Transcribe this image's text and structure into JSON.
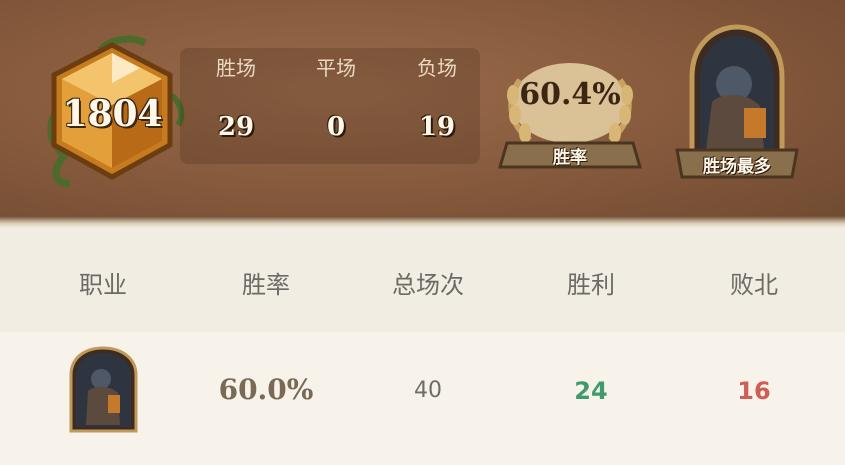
{
  "rank": {
    "value": "1804",
    "icon": "hexagon-rank-icon"
  },
  "stats": {
    "labels": [
      "胜场",
      "平场",
      "负场"
    ],
    "values": [
      "29",
      "0",
      "19"
    ]
  },
  "win_rate": {
    "value": "60.4%",
    "label": "胜率"
  },
  "most_wins": {
    "label": "胜场最多",
    "icon": "hero-portrait-icon"
  },
  "table": {
    "headers": [
      "职业",
      "胜率",
      "总场次",
      "胜利",
      "败北"
    ],
    "rows": [
      {
        "win_rate": "60.0%",
        "total": "40",
        "wins": "24",
        "losses": "16",
        "icon": "hero-portrait-icon"
      }
    ]
  },
  "colors": {
    "win": "#3f9a6d",
    "loss": "#cf5e55",
    "header_bg": "#84583b"
  }
}
